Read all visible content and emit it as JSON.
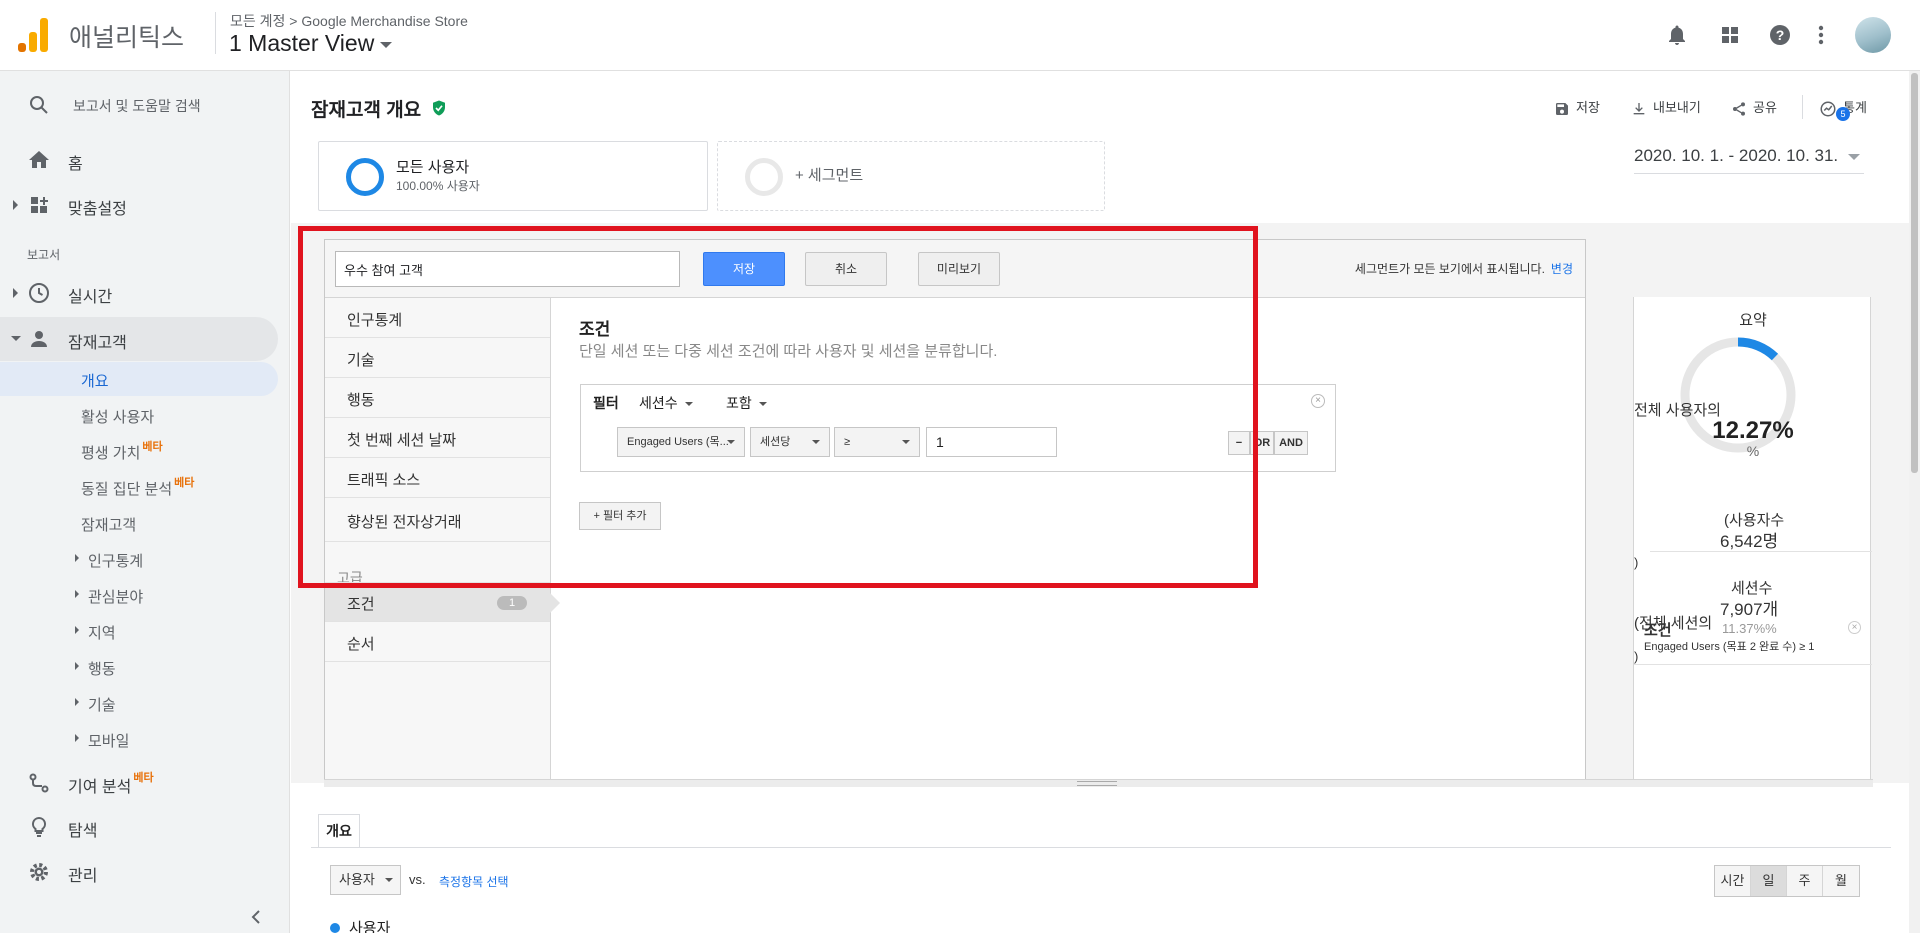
{
  "header": {
    "app_name": "애널리틱스",
    "breadcrumb": "모든 계정 > Google Merchandise Store",
    "view_name": "1 Master View",
    "icons": [
      "bell-icon",
      "apps-icon",
      "help-icon",
      "more-vert-icon"
    ]
  },
  "sidebar": {
    "search_placeholder": "보고서 및 도움말 검색",
    "home": "홈",
    "customization": "맞춤설정",
    "section_label": "보고서",
    "realtime": "실시간",
    "audience": "잠재고객",
    "audience_items": [
      {
        "label": "개요"
      },
      {
        "label": "활성 사용자"
      },
      {
        "label": "평생 가치",
        "badge": "베타"
      },
      {
        "label": "동질 집단 분석",
        "badge": "베타"
      },
      {
        "label": "잠재고객"
      },
      {
        "label": "인구통계"
      },
      {
        "label": "관심분야"
      },
      {
        "label": "지역"
      },
      {
        "label": "행동"
      },
      {
        "label": "기술"
      },
      {
        "label": "모바일"
      }
    ],
    "attribution": "기여 분석",
    "attribution_badge": "베타",
    "discover": "탐색",
    "admin": "관리"
  },
  "page": {
    "title": "잠재고객 개요",
    "toolbar": {
      "save": "저장",
      "export": "내보내기",
      "share": "공유",
      "insights": "통계",
      "insights_badge": "5"
    },
    "segments": [
      {
        "name": "모든 사용자",
        "sub": "100.00% 사용자"
      },
      {
        "name": "+ 세그먼트",
        "sub": ""
      }
    ],
    "date_range": "2020. 10. 1. - 2020. 10. 31."
  },
  "editor": {
    "segment_name": "우수 참여 고객",
    "save_btn": "저장",
    "cancel_btn": "취소",
    "preview_btn": "미리보기",
    "note": "세그먼트가 모든 보기에서 표시됩니다.",
    "note_link": "변경",
    "menu": [
      "인구통계",
      "기술",
      "행동",
      "첫 번째 세션 날짜",
      "트래픽 소스",
      "향상된 전자상거래"
    ],
    "advanced_label": "고급",
    "advanced_items": [
      {
        "label": "조건",
        "count": "1"
      },
      {
        "label": "순서",
        "count": ""
      }
    ],
    "condition_title": "조건",
    "condition_desc": "단일 세션 또는 다중 세션 조건에 따라 사용자 및 세션을 분류합니다.",
    "filter": {
      "label": "필터",
      "scope": "세션수",
      "mode": "포함",
      "metric": "Engaged Users (목...",
      "per": "세션당",
      "operator": "≥",
      "value": "1",
      "minus": "−",
      "or": "OR",
      "and": "AND"
    },
    "add_filter": "+ 필터 추가",
    "summary": {
      "title": "요약",
      "all_users_of": "전체 사용자의",
      "percent": "12.27%",
      "percent_symbol": "%",
      "users_label": "(사용자수",
      "users_value": "6,542명",
      "close_paren_1": ")",
      "sessions_label": "세션수",
      "sessions_value": "7,907개",
      "all_sessions_of": "(전체 세션의",
      "sessions_pct": "11.37%%",
      "cond_label": "조건",
      "cond_text": "Engaged Users (목표 2 완료 수) ≥ 1",
      "close_paren_2": ")",
      "ring_fraction": 0.1227
    }
  },
  "overview": {
    "tab": "개요",
    "metric": "사용자",
    "vs": "vs.",
    "select_metric": "측정항목 선택",
    "time_buttons": [
      "시간",
      "일",
      "주",
      "월"
    ],
    "time_active": "일",
    "legend": "사용자"
  },
  "colors": {
    "accent_blue": "#1e88e5",
    "highlight_red": "#e0131e",
    "primary_button": "#4d90fe",
    "logo_orange": "#f9ab00"
  }
}
